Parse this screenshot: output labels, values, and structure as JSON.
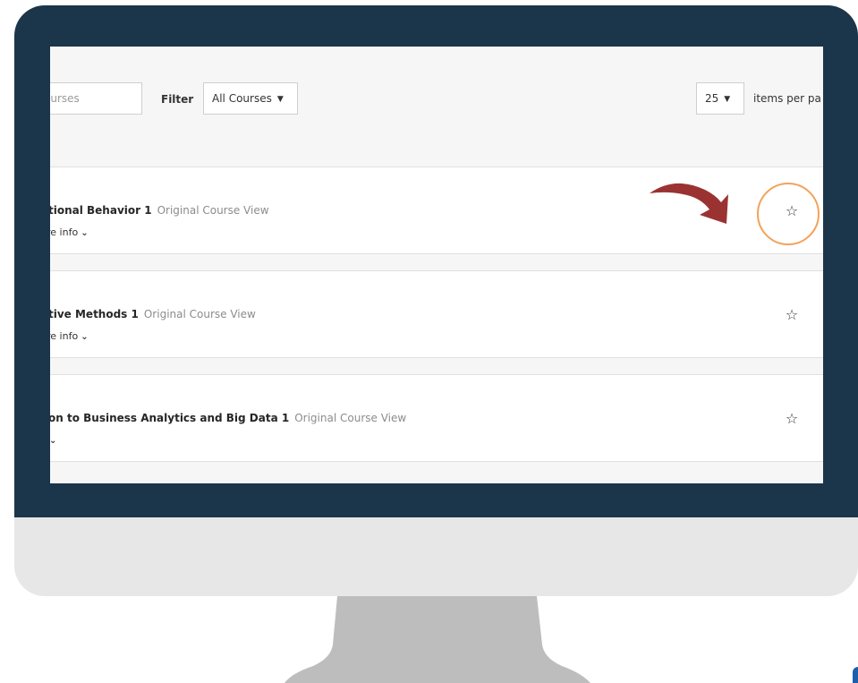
{
  "toolbar": {
    "search_placeholder": "ourses",
    "filter_label": "Filter",
    "filter_value": "All Courses",
    "per_page_value": "25",
    "per_page_label": "items per pa"
  },
  "courses": [
    {
      "title": "tional Behavior 1",
      "view": "Original Course View",
      "more_info": "re info"
    },
    {
      "title": "tive Methods 1",
      "view": "Original Course View",
      "more_info": "re info"
    },
    {
      "title": "on to Business Analytics and Big Data 1",
      "view": "Original Course View",
      "more_info": ""
    }
  ],
  "icons": {
    "star": "star-outline-icon",
    "chevron": "chevron-down-icon",
    "caret": "caret-down-icon"
  },
  "colors": {
    "monitor": "#1b354b",
    "chin": "#e7e7e7",
    "stand": "#bdbdbd",
    "arrow": "#9b3232",
    "ring": "#f3a25b"
  }
}
